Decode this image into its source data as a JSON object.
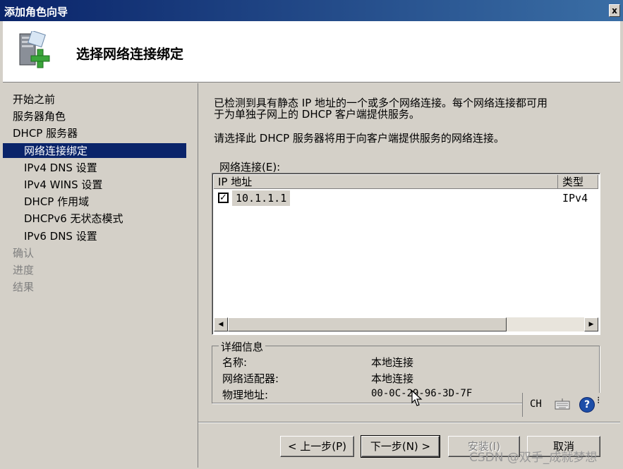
{
  "window": {
    "title": "添加角色向导",
    "close_glyph": "x"
  },
  "header": {
    "title": "选择网络连接绑定",
    "icon": "server-add-icon"
  },
  "sidebar": {
    "items": [
      {
        "label": "开始之前",
        "state": "normal"
      },
      {
        "label": "服务器角色",
        "state": "normal"
      },
      {
        "label": "DHCP 服务器",
        "state": "normal"
      },
      {
        "label": "网络连接绑定",
        "state": "selected"
      },
      {
        "label": "IPv4 DNS 设置",
        "state": "normal"
      },
      {
        "label": "IPv4 WINS 设置",
        "state": "normal"
      },
      {
        "label": "DHCP 作用域",
        "state": "normal"
      },
      {
        "label": "DHCPv6 无状态模式",
        "state": "normal"
      },
      {
        "label": "IPv6 DNS 设置",
        "state": "normal"
      },
      {
        "label": "确认",
        "state": "disabled"
      },
      {
        "label": "进度",
        "state": "disabled"
      },
      {
        "label": "结果",
        "state": "disabled"
      }
    ]
  },
  "main": {
    "intro_line1": "已检测到具有静态 IP 地址的一个或多个网络连接。每个网络连接都可用",
    "intro_line2": "于为单独子网上的 DHCP 客户端提供服务。",
    "instruction": "请选择此 DHCP 服务器将用于向客户端提供服务的网络连接。",
    "list_label": "网络连接(E):",
    "columns": [
      "IP 地址",
      "类型"
    ],
    "rows": [
      {
        "checked": true,
        "check_glyph": "✓",
        "ip": "10.1.1.1",
        "type": "IPv4"
      }
    ],
    "details": {
      "legend": "详细信息",
      "name_label": "名称:",
      "name_value": "本地连接",
      "adapter_label": "网络适配器:",
      "adapter_value": "本地连接",
      "mac_label": "物理地址:",
      "mac_value": "00-0C-29-96-3D-7F"
    }
  },
  "langbar": {
    "lang": "CH",
    "help_glyph": "?",
    "options_glyph": "⁝"
  },
  "buttons": {
    "back": "< 上一步(P)",
    "next": "下一步(N) >",
    "install": "安装(I)",
    "cancel": "取消"
  },
  "watermark": "CSDN @双手_成就梦想"
}
